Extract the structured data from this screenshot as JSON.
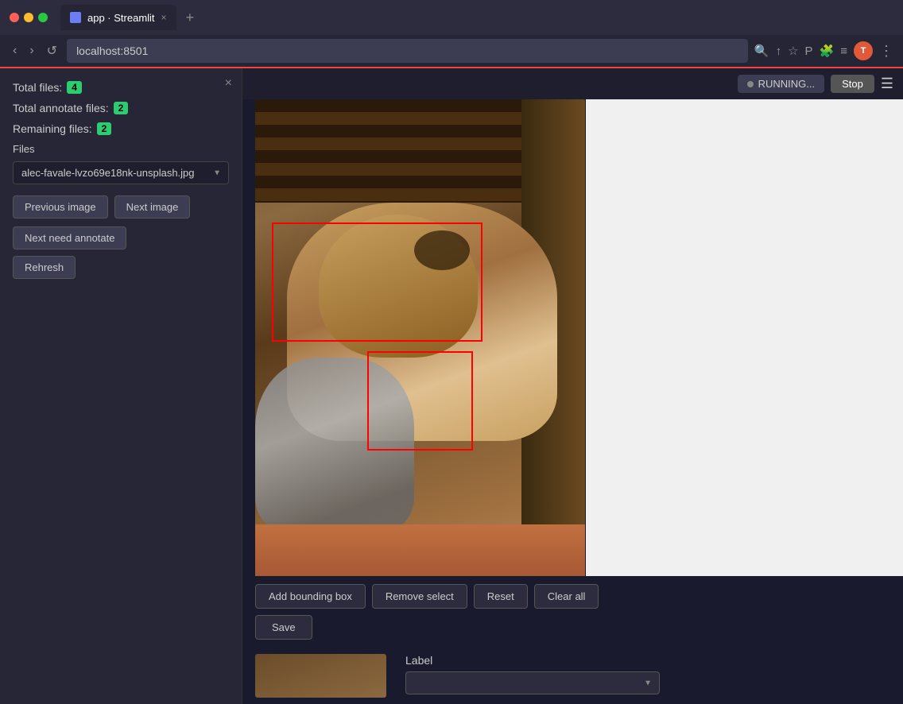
{
  "browser": {
    "tab_label": "app · Streamlit",
    "tab_close": "×",
    "tab_new": "+",
    "url": "localhost:8501",
    "back": "‹",
    "forward": "›",
    "reload": "↺",
    "avatar_label": "T",
    "running_label": "RUNNING...",
    "stop_label": "Stop"
  },
  "sidebar": {
    "close_icon": "×",
    "total_files_label": "Total files:",
    "total_files_value": "4",
    "total_annotate_label": "Total annotate files:",
    "total_annotate_value": "2",
    "remaining_label": "Remaining files:",
    "remaining_value": "2",
    "files_section_label": "Files",
    "file_dropdown_value": "alec-favale-lvzo69e18nk-unsplash.jpg",
    "prev_image_btn": "Previous image",
    "next_image_btn": "Next image",
    "next_need_annotate_btn": "Next need annotate",
    "refresh_btn": "Rehresh"
  },
  "main": {
    "add_bbox_btn": "Add bounding box",
    "remove_select_btn": "Remove select",
    "reset_btn": "Reset",
    "clear_all_btn": "Clear all",
    "save_btn": "Save",
    "label_header": "Label",
    "label_placeholder": ""
  },
  "colors": {
    "badge_green": "#2ecc71",
    "bbox_red": "#ff0000",
    "accent": "#e05a3a"
  }
}
